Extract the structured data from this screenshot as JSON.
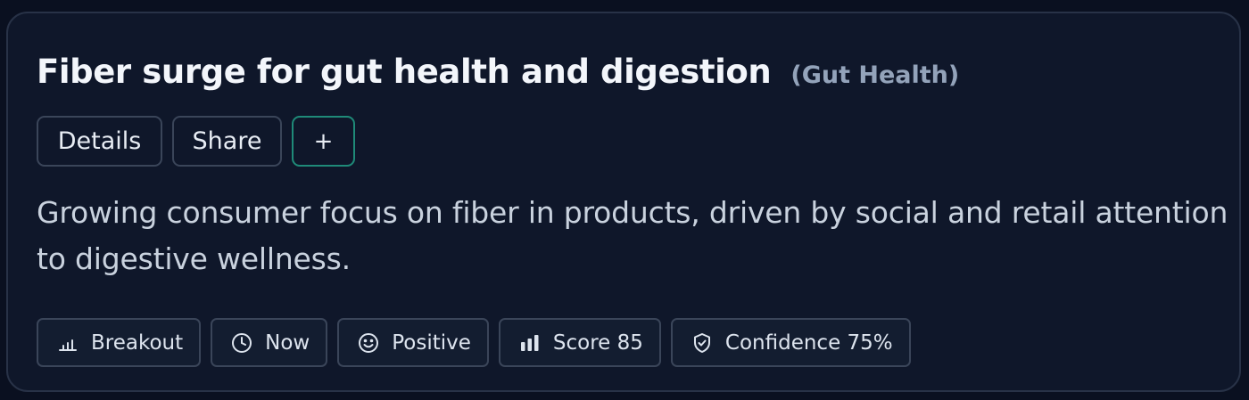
{
  "card": {
    "title": "Fiber surge for gut health and digestion",
    "category": "Gut Health",
    "description": "Growing consumer focus on fiber in products, driven by social and retail attention to digestive wellness."
  },
  "actions": {
    "details_label": "Details",
    "share_label": "Share",
    "add_label": "+"
  },
  "badges": [
    {
      "icon": "bar-chart-rising-icon",
      "label": "Breakout"
    },
    {
      "icon": "clock-icon",
      "label": "Now"
    },
    {
      "icon": "smile-icon",
      "label": "Positive"
    },
    {
      "icon": "bar-chart-icon",
      "label": "Score 85"
    },
    {
      "icon": "shield-check-icon",
      "label": "Confidence 75%"
    }
  ],
  "colors": {
    "background": "#0a1020",
    "card": "#0f172a",
    "accent": "#1f8a78",
    "muted": "#93a3ba"
  }
}
